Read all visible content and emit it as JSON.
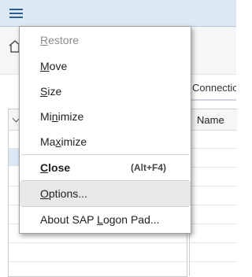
{
  "window": {
    "tab_label": "Connectio",
    "list_header_name": "Name"
  },
  "system_menu": {
    "items": [
      {
        "key": "restore",
        "before": "",
        "mnemonic": "R",
        "after": "estore",
        "accel": "",
        "enabled": false
      },
      {
        "key": "move",
        "before": "",
        "mnemonic": "M",
        "after": "ove",
        "accel": "",
        "enabled": true
      },
      {
        "key": "size",
        "before": "",
        "mnemonic": "S",
        "after": "ize",
        "accel": "",
        "enabled": true
      },
      {
        "key": "minimize",
        "before": "Mi",
        "mnemonic": "n",
        "after": "imize",
        "accel": "",
        "enabled": true
      },
      {
        "key": "maximize",
        "before": "Ma",
        "mnemonic": "x",
        "after": "imize",
        "accel": "",
        "enabled": true
      },
      {
        "key": "close",
        "before": "",
        "mnemonic": "C",
        "after": "lose",
        "accel": "(Alt+F4)",
        "enabled": true
      },
      {
        "key": "options",
        "before": "",
        "mnemonic": "O",
        "after": "ptions...",
        "accel": "",
        "enabled": true
      },
      {
        "key": "about",
        "before": "About SAP ",
        "mnemonic": "L",
        "after": "ogon Pad...",
        "accel": "",
        "enabled": true
      }
    ]
  },
  "colors": {
    "titlebar": "#dce8f3",
    "accent": "#2c5f9a",
    "menu_hover": "#e8e8e8",
    "disabled_text": "#8c8c8c"
  }
}
